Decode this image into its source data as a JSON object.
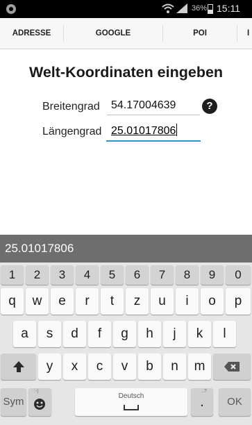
{
  "status_bar": {
    "battery": "36%",
    "time": "15:11",
    "icons": [
      "app-icon",
      "wifi-icon",
      "signal-icon",
      "battery-icon"
    ]
  },
  "tabs": [
    {
      "label": "ADRESSE"
    },
    {
      "label": "GOOGLE"
    },
    {
      "label": "POI"
    },
    {
      "label": "I"
    }
  ],
  "main": {
    "title": "Welt-Koordinaten eingeben",
    "latitude_label": "Breitengrad",
    "latitude_value": "54.17004639",
    "longitude_label": "Längengrad",
    "longitude_value": "25.01017806",
    "help_symbol": "?"
  },
  "suggestion_bar": {
    "text": "25.01017806"
  },
  "keyboard": {
    "number_row": [
      "1",
      "2",
      "3",
      "4",
      "5",
      "6",
      "7",
      "8",
      "9",
      "0"
    ],
    "row1": [
      "q",
      "w",
      "e",
      "r",
      "t",
      "z",
      "u",
      "i",
      "o",
      "p"
    ],
    "row2": [
      "a",
      "s",
      "d",
      "f",
      "g",
      "h",
      "j",
      "k",
      "l"
    ],
    "row3": [
      "y",
      "x",
      "c",
      "v",
      "b",
      "n",
      "m"
    ],
    "sym": "Sym",
    "space_language": "Deutsch",
    "period": ".",
    "period_hint": "..?",
    "emoji_hint": ":-)",
    "ok": "OK",
    "icons": [
      "shift-icon",
      "backspace-icon",
      "emoji-icon",
      "space-icon"
    ]
  },
  "colors": {
    "accent": "#2b93d6",
    "suggestion_bar": "#6e6e6e",
    "keyboard_bg": "#e6e6e6"
  }
}
